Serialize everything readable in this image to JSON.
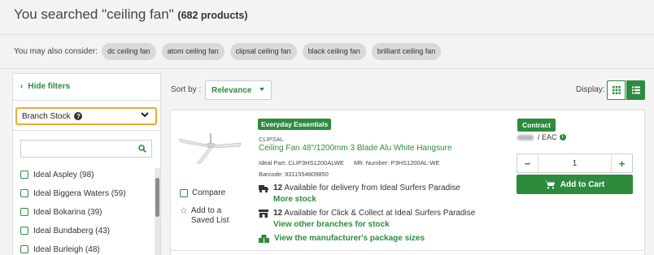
{
  "header": {
    "title_prefix": "You searched \"ceiling fan\"",
    "count": "(682 products)"
  },
  "consider": {
    "label": "You may also consider:",
    "chips": [
      "dc ceiling fan",
      "atom ceiling fan",
      "clipsal ceiling fan",
      "black ceiling fan",
      "brilliant ceiling fan"
    ]
  },
  "sidebar": {
    "hide_filters": "Hide filters",
    "branch_stock": "Branch Stock",
    "help_glyph": "?",
    "search_placeholder": "",
    "branches": [
      "Ideal Aspley (98)",
      "Ideal Biggera Waters (59)",
      "Ideal Bokarina (39)",
      "Ideal Bundaberg (43)",
      "Ideal Burleigh (48)"
    ]
  },
  "toolbar": {
    "sort_label": "Sort by :",
    "sort_value": "Relevance",
    "display_label": "Display:"
  },
  "product": {
    "badge": "Everyday Essentials",
    "brand": "CLIPSAL",
    "title": "Ceiling Fan 48\"/1200mm 3 Blade Alu White Hangsure",
    "ideal_part": "Ideal Part:  CLIP3HS1200ALWE",
    "mfr_number": "Mfr. Number:  P3HS1200AL-WE",
    "barcode": "Barcode:  9311554809850",
    "compare_label": "Compare",
    "saved_list_label_1": "Add to a",
    "saved_list_label_2": "Saved List",
    "delivery_count": "12",
    "delivery_text": " Available for delivery from Ideal Surfers Paradise",
    "delivery_link": "More stock",
    "collect_count": "12",
    "collect_text": " Available for Click & Collect at Ideal Surfers Paradise",
    "collect_link": "View other branches for stock",
    "package_link": "View the manufacturer's package sizes",
    "contract_badge": "Contract",
    "price_unit": "/ EAC",
    "info_glyph": "i",
    "qty_minus": "−",
    "qty_value": "1",
    "qty_plus": "+",
    "add_to_cart": "Add to Cart"
  },
  "colors": {
    "accent": "#2e8b3e",
    "highlight_border": "#f0a830",
    "chip_bg": "#d9d9d9"
  },
  "icons": [
    "chevron-left-icon",
    "help-icon",
    "chevron-down-icon",
    "search-icon",
    "grid-view-icon",
    "list-view-icon",
    "star-icon",
    "truck-icon",
    "store-icon",
    "boxes-icon",
    "info-icon",
    "cart-icon"
  ]
}
